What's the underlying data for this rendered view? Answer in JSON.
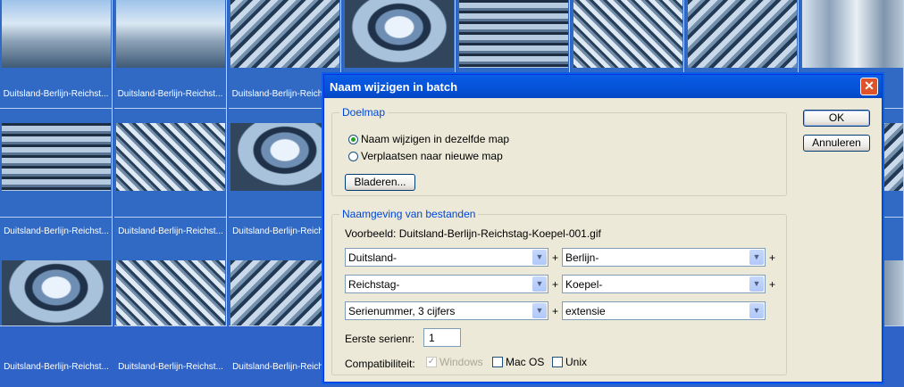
{
  "thumbnails": {
    "caption": "Duitsland-Berlijn-Reichst...",
    "rows": [
      [
        {
          "visible_caption": true
        },
        {
          "visible_caption": true
        },
        {
          "visible_caption": true
        },
        {
          "visible_caption": false
        },
        {
          "visible_caption": false
        },
        {
          "visible_caption": false
        },
        {
          "visible_caption": false
        },
        {
          "visible_caption": false
        }
      ]
    ]
  },
  "dialog": {
    "title": "Naam wijzigen in batch",
    "close_glyph": "✕",
    "ok_label": "OK",
    "cancel_label": "Annuleren",
    "target_group": {
      "legend": "Doelmap",
      "option_same": "Naam wijzigen in dezelfde map",
      "option_move": "Verplaatsen naar nieuwe map",
      "selected": "option_same",
      "browse_label": "Bladeren..."
    },
    "naming_group": {
      "legend": "Naamgeving van bestanden",
      "example_label": "Voorbeeld:",
      "example_value": "Duitsland-Berlijn-Reichstag-Koepel-001.gif",
      "fields": [
        "Duitsland-",
        "Berlijn-",
        "Reichstag-",
        "Koepel-",
        "Serienummer, 3 cijfers",
        "extensie"
      ],
      "plus": "+",
      "first_serial_label": "Eerste serienr:",
      "first_serial_value": "1",
      "compat_label": "Compatibiliteit:",
      "compat_windows": "Windows",
      "compat_macos": "Mac OS",
      "compat_unix": "Unix",
      "windows_checked": true,
      "macos_checked": false,
      "unix_checked": false
    }
  },
  "icons": {
    "dropdown_arrow": "▼",
    "checkmark": "✓"
  }
}
